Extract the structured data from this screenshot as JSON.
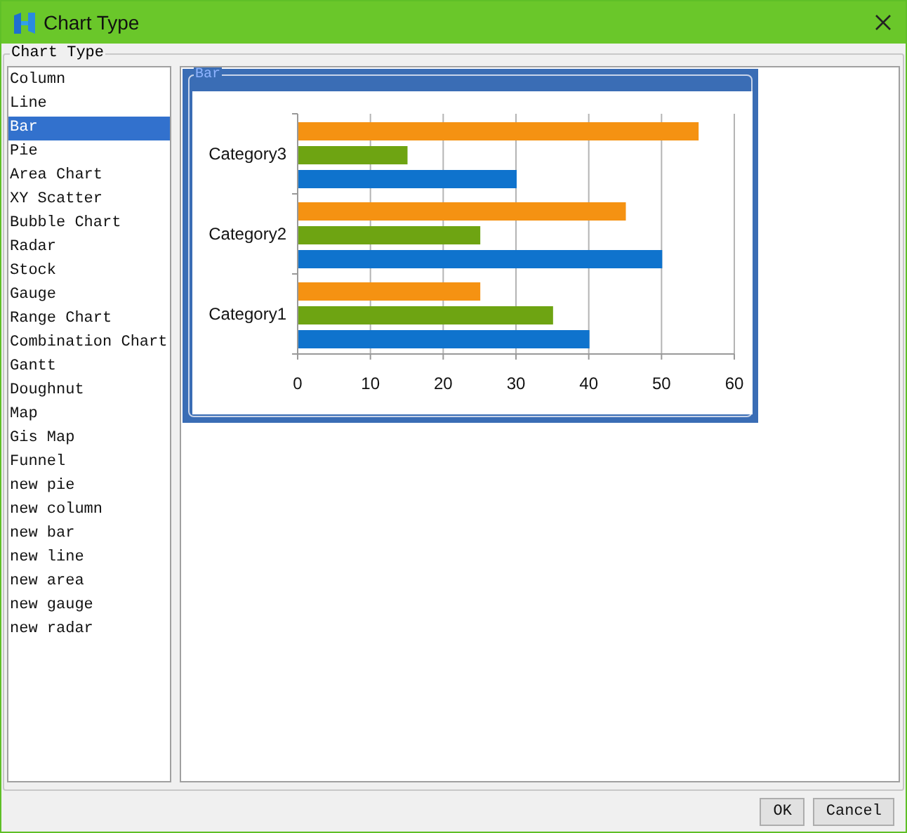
{
  "window": {
    "title": "Chart Type"
  },
  "group_title": "Chart Type",
  "chart_types": [
    {
      "label": "Column",
      "selected": false
    },
    {
      "label": "Line",
      "selected": false
    },
    {
      "label": "Bar",
      "selected": true
    },
    {
      "label": "Pie",
      "selected": false
    },
    {
      "label": "Area Chart",
      "selected": false
    },
    {
      "label": "XY Scatter",
      "selected": false
    },
    {
      "label": "Bubble Chart",
      "selected": false
    },
    {
      "label": "Radar",
      "selected": false
    },
    {
      "label": "Stock",
      "selected": false
    },
    {
      "label": "Gauge",
      "selected": false
    },
    {
      "label": "Range Chart",
      "selected": false
    },
    {
      "label": "Combination Chart",
      "selected": false
    },
    {
      "label": "Gantt",
      "selected": false
    },
    {
      "label": "Doughnut",
      "selected": false
    },
    {
      "label": "Map",
      "selected": false
    },
    {
      "label": "Gis Map",
      "selected": false
    },
    {
      "label": "Funnel",
      "selected": false
    },
    {
      "label": "new pie",
      "selected": false
    },
    {
      "label": "new column",
      "selected": false
    },
    {
      "label": "new bar",
      "selected": false
    },
    {
      "label": "new line",
      "selected": false
    },
    {
      "label": "new area",
      "selected": false
    },
    {
      "label": "new gauge",
      "selected": false
    },
    {
      "label": "new radar",
      "selected": false
    }
  ],
  "preview": {
    "title": "Bar",
    "selected": true,
    "chart_data": {
      "type": "bar",
      "orientation": "horizontal",
      "categories": [
        "Category3",
        "Category2",
        "Category1"
      ],
      "series": [
        {
          "color": "#0f73cd",
          "values": [
            30,
            50,
            40
          ]
        },
        {
          "color": "#6ea412",
          "values": [
            15,
            25,
            35
          ]
        },
        {
          "color": "#f59212",
          "values": [
            55,
            45,
            25
          ]
        }
      ],
      "grid": true,
      "xlim": [
        0,
        60
      ],
      "xticks": [
        0,
        10,
        20,
        30,
        40,
        50,
        60
      ]
    }
  },
  "buttons": [
    "OK",
    "Cancel"
  ]
}
